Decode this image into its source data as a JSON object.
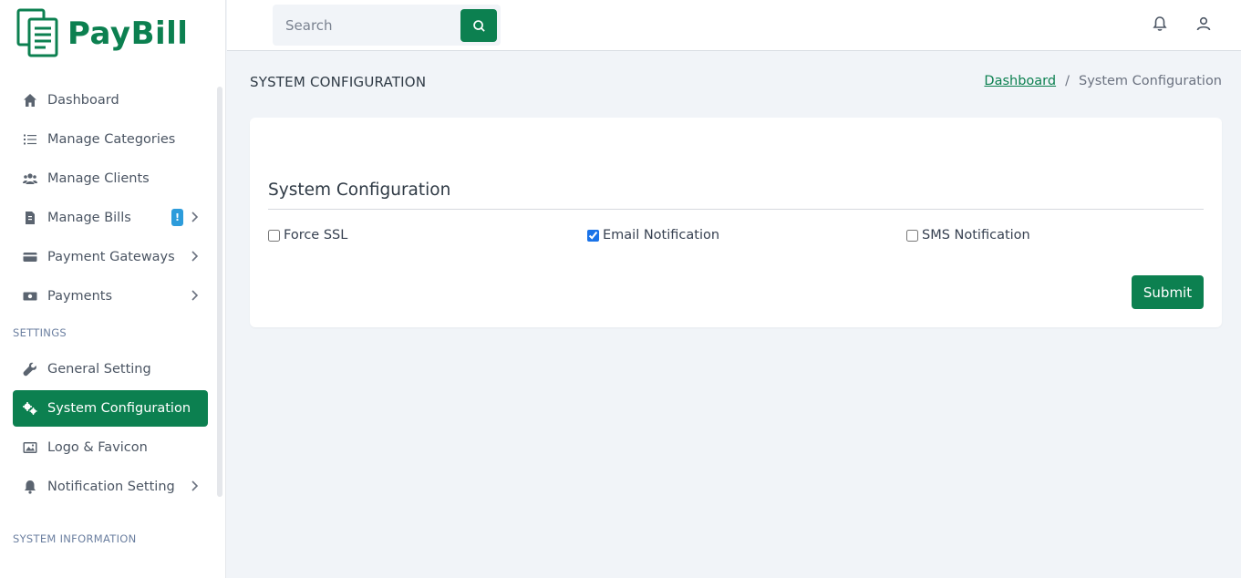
{
  "brand": {
    "name": "PayBill",
    "color": "#0c8050"
  },
  "search": {
    "placeholder": "Search",
    "value": ""
  },
  "sidebar": {
    "items": [
      {
        "label": "Dashboard",
        "icon": "home-icon"
      },
      {
        "label": "Manage Categories",
        "icon": "list-icon"
      },
      {
        "label": "Manage Clients",
        "icon": "users-icon"
      },
      {
        "label": "Manage Bills",
        "icon": "file-invoice-icon",
        "badge": "!"
      },
      {
        "label": "Payment Gateways",
        "icon": "credit-card-icon"
      },
      {
        "label": "Payments",
        "icon": "money-icon"
      }
    ],
    "settings_title": "SETTINGS",
    "settings_items": [
      {
        "label": "General Setting",
        "icon": "wrench-icon"
      },
      {
        "label": "System Configuration",
        "icon": "gears-icon",
        "active": true
      },
      {
        "label": "Logo & Favicon",
        "icon": "image-icon"
      },
      {
        "label": "Notification Setting",
        "icon": "bell-icon"
      }
    ],
    "system_info_title": "SYSTEM INFORMATION"
  },
  "page": {
    "title": "SYSTEM CONFIGURATION",
    "breadcrumb": {
      "link": "Dashboard",
      "separator": "/",
      "current": "System Configuration"
    }
  },
  "card": {
    "title": "System Configuration",
    "options": [
      {
        "label": "Force SSL",
        "checked": false
      },
      {
        "label": "Email Notification",
        "checked": true
      },
      {
        "label": "SMS Notification",
        "checked": false
      }
    ],
    "submit_label": "Submit"
  }
}
